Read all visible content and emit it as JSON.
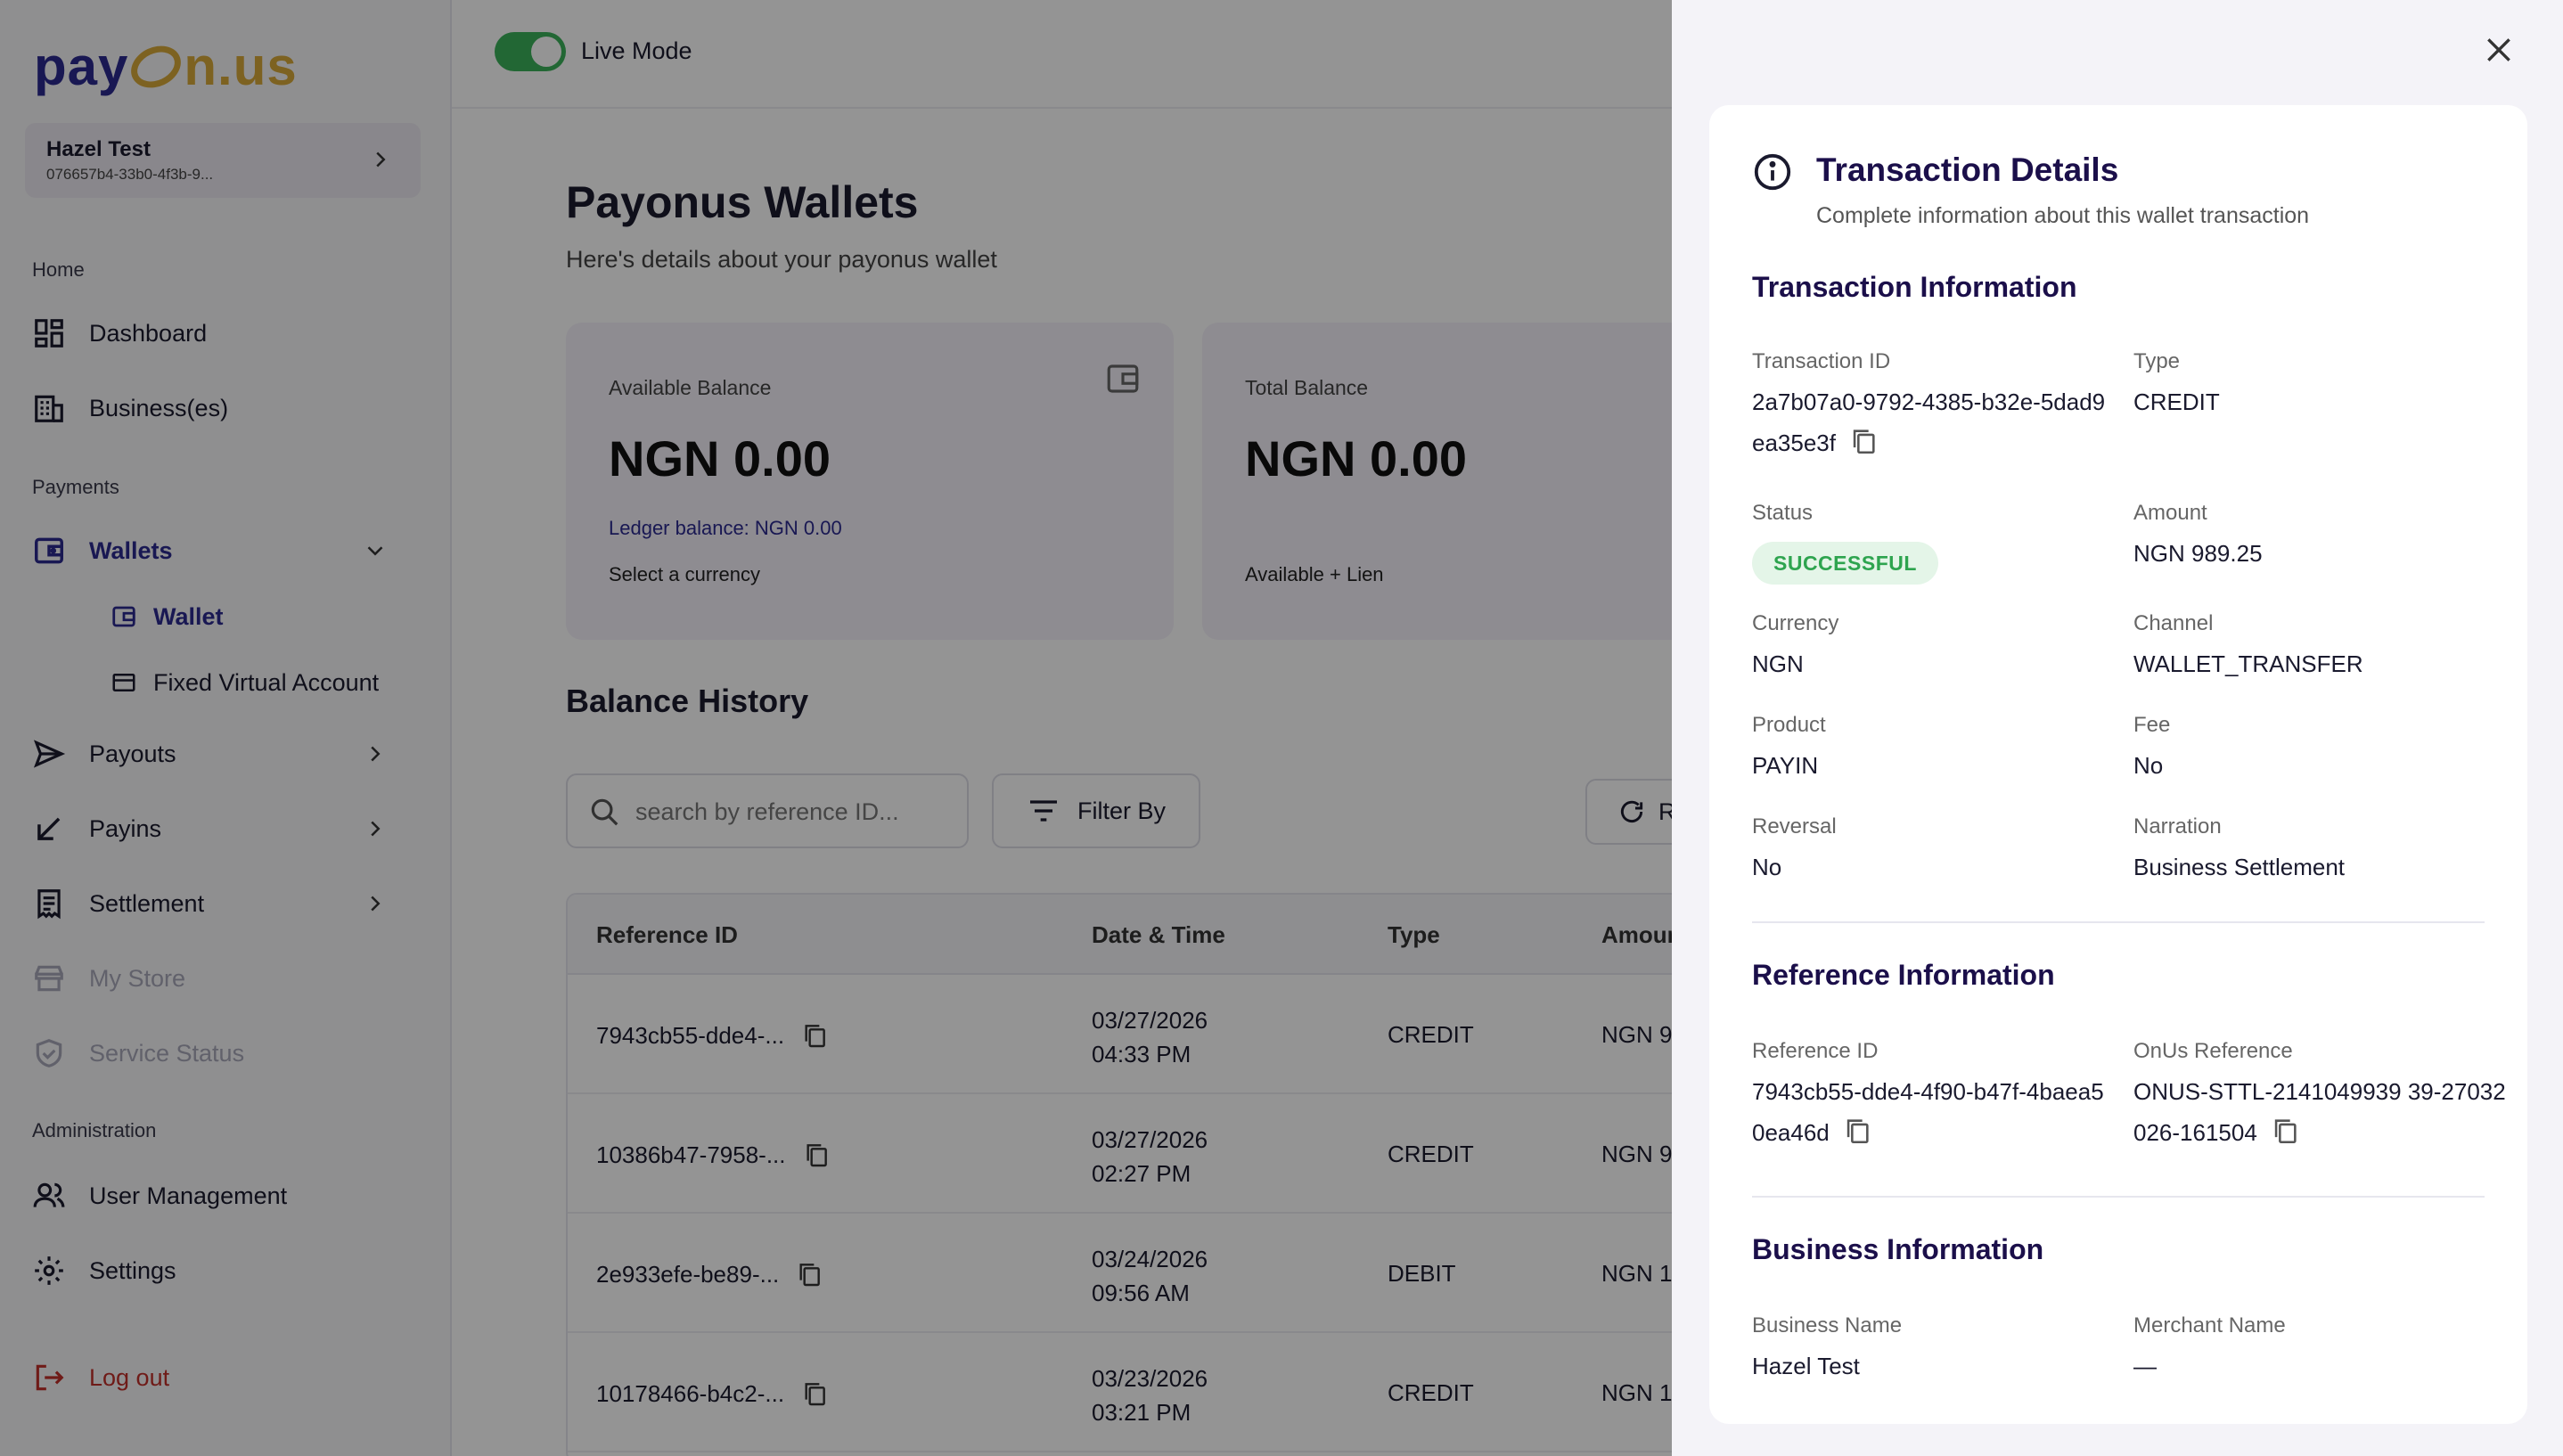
{
  "sidebar": {
    "logo": {
      "part1": "pay",
      "part2": "n.us"
    },
    "account": {
      "name": "Hazel Test",
      "id": "076657b4-33b0-4f3b-9..."
    },
    "sections": {
      "home": "Home",
      "payments": "Payments",
      "administration": "Administration"
    },
    "items": {
      "dashboard": "Dashboard",
      "businesses": "Business(es)",
      "wallets": "Wallets",
      "wallet": "Wallet",
      "fixed_virtual_account": "Fixed Virtual Account",
      "payouts": "Payouts",
      "payins": "Payins",
      "settlement": "Settlement",
      "my_store": "My Store",
      "service_status": "Service Status",
      "user_management": "User Management",
      "settings": "Settings",
      "logout": "Log out"
    }
  },
  "topbar": {
    "live_mode_label": "Live Mode",
    "live_mode_on": true
  },
  "main": {
    "title": "Payonus Wallets",
    "subtitle": "Here's details about your payonus wallet",
    "cards": [
      {
        "label": "Available Balance",
        "amount": "NGN 0.00",
        "ledger": "Ledger balance: NGN 0.00",
        "footer": "Select a currency"
      },
      {
        "label": "Total Balance",
        "amount": "NGN 0.00",
        "footer": "Available + Lien"
      }
    ],
    "balance_history_title": "Balance History",
    "search_placeholder": "search by reference ID...",
    "filter_label": "Filter By",
    "refresh_label": "R",
    "table": {
      "headers": [
        "Reference ID",
        "Date & Time",
        "Type",
        "Amour"
      ],
      "rows": [
        {
          "ref": "7943cb55-dde4-...",
          "date": "03/27/2026",
          "time": "04:33 PM",
          "type": "CREDIT",
          "amount": "NGN 9"
        },
        {
          "ref": "10386b47-7958-...",
          "date": "03/27/2026",
          "time": "02:27 PM",
          "type": "CREDIT",
          "amount": "NGN 9"
        },
        {
          "ref": "2e933efe-be89-...",
          "date": "03/24/2026",
          "time": "09:56 AM",
          "type": "DEBIT",
          "amount": "NGN 1,"
        },
        {
          "ref": "10178466-b4c2-...",
          "date": "03/23/2026",
          "time": "03:21 PM",
          "type": "CREDIT",
          "amount": "NGN 1,"
        }
      ]
    }
  },
  "drawer": {
    "title": "Transaction Details",
    "subtitle": "Complete information about this wallet transaction",
    "transaction_info": {
      "heading": "Transaction Information",
      "transaction_id_label": "Transaction ID",
      "transaction_id": "2a7b07a0-9792-4385-b32e-5dad9ea35e3f",
      "type_label": "Type",
      "type": "CREDIT",
      "status_label": "Status",
      "status": "SUCCESSFUL",
      "amount_label": "Amount",
      "amount": "NGN 989.25",
      "currency_label": "Currency",
      "currency": "NGN",
      "channel_label": "Channel",
      "channel": "WALLET_TRANSFER",
      "product_label": "Product",
      "product": "PAYIN",
      "fee_label": "Fee",
      "fee": "No",
      "reversal_label": "Reversal",
      "reversal": "No",
      "narration_label": "Narration",
      "narration": "Business Settlement"
    },
    "reference_info": {
      "heading": "Reference Information",
      "reference_id_label": "Reference ID",
      "reference_id": "7943cb55-dde4-4f90-b47f-4baea50ea46d",
      "onus_reference_label": "OnUs Reference",
      "onus_reference": "ONUS-STTL-2141049939 39-27032026-161504"
    },
    "business_info": {
      "heading": "Business Information",
      "business_name_label": "Business Name",
      "business_name": "Hazel Test",
      "merchant_name_label": "Merchant Name",
      "merchant_name": "—"
    }
  },
  "colors": {
    "brand_primary": "#2c2a8f",
    "brand_gold": "#d8a93a",
    "live_toggle": "#3bb15a",
    "success_text": "#2ea44f",
    "success_bg": "#e4f5e8",
    "logout": "#c0302a",
    "heading_dark": "#1b0f4a"
  }
}
